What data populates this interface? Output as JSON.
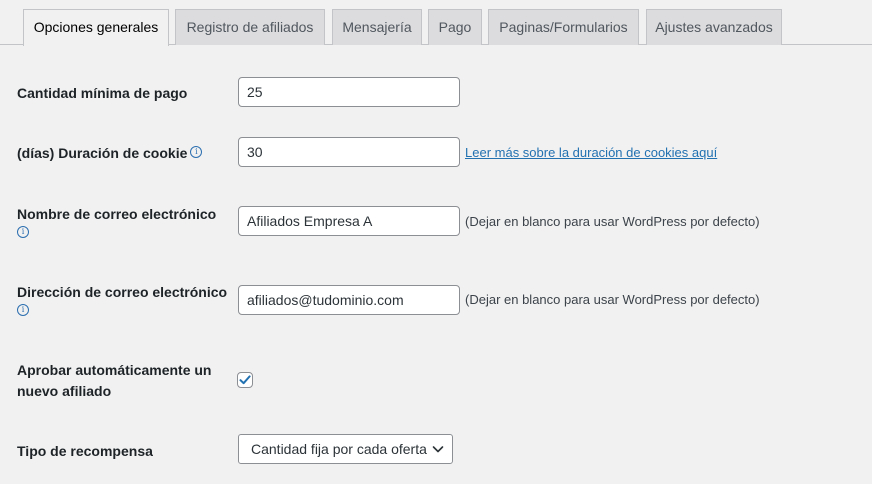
{
  "tabs": [
    {
      "label": "Opciones generales",
      "active": true
    },
    {
      "label": "Registro de afiliados",
      "active": false
    },
    {
      "label": "Mensajería",
      "active": false
    },
    {
      "label": "Pago",
      "active": false
    },
    {
      "label": "Paginas/Formularios",
      "active": false
    },
    {
      "label": "Ajustes avanzados",
      "active": false
    }
  ],
  "fields": {
    "min_payment": {
      "label": "Cantidad mínima de pago",
      "value": "25"
    },
    "cookie_duration": {
      "label": "(días) Duración de cookie",
      "value": "30",
      "link": "Leer más sobre la duración de cookies aquí"
    },
    "email_name": {
      "label": "Nombre de correo electrónico",
      "value": "Afiliados Empresa A",
      "hint": "(Dejar en blanco para usar WordPress por defecto)"
    },
    "email_address": {
      "label": "Dirección de correo electrónico",
      "value": "afiliados@tudominio.com",
      "hint": "(Dejar en blanco para usar WordPress por defecto)"
    },
    "auto_approve": {
      "label_line1": "Aprobar automáticamente un",
      "label_line2": "nuevo afiliado",
      "checked": true
    },
    "reward_type": {
      "label": "Tipo de recompensa",
      "selected": "Cantidad fija por cada oferta"
    }
  },
  "icons": {
    "info": "info-icon",
    "checkmark": "checkmark-icon",
    "chevron": "chevron-down-icon"
  },
  "colors": {
    "link": "#2271b1",
    "checkmark": "#2271b1",
    "background": "#f1f1f1",
    "inactive_tab": "#dcdcde"
  }
}
